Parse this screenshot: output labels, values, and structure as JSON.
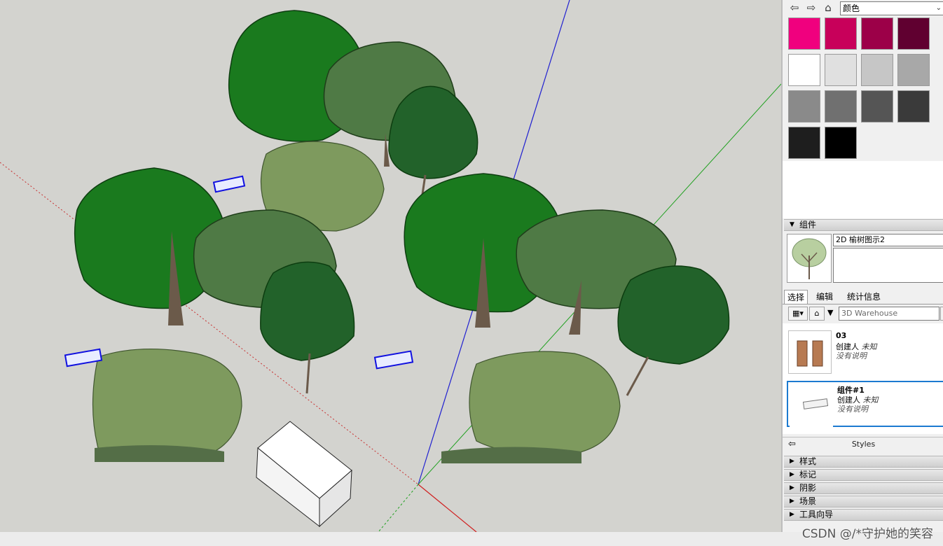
{
  "panel": {
    "materials": {
      "dropdown_value": "颜色",
      "swatches": [
        "#f0007e",
        "#c8005a",
        "#9c0048",
        "#600030",
        "#ffffff",
        "#e0e0e0",
        "#c6c6c6",
        "#a8a8a8",
        "#8a8a8a",
        "#707070",
        "#555555",
        "#3a3a3a",
        "#1e1e1e",
        "#000000"
      ]
    },
    "components": {
      "section_label": "组件",
      "name_value": "2D 榆树图示2",
      "tabs": [
        "选择",
        "编辑",
        "统计信息"
      ],
      "search_placeholder": "3D Warehouse",
      "items": [
        {
          "title": "03",
          "author_label": "创建人",
          "author_value": "未知",
          "desc": "没有说明"
        },
        {
          "title": "组件#1",
          "author_label": "创建人",
          "author_value": "未知",
          "desc": "没有说明"
        }
      ]
    },
    "styles_label": "Styles",
    "collapsed_sections": [
      "样式",
      "标记",
      "阴影",
      "场景",
      "工具向导"
    ]
  },
  "watermark": "CSDN @/*守护她的笑容"
}
